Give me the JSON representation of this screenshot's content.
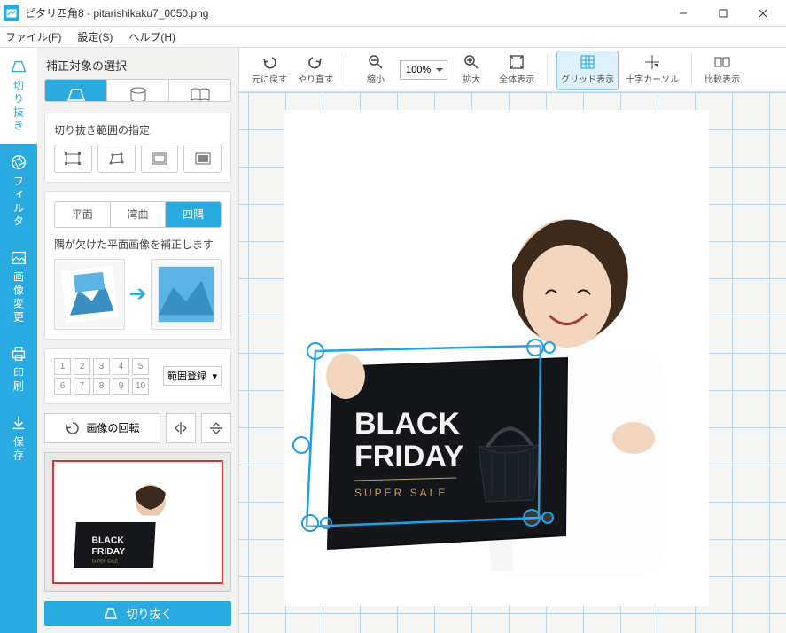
{
  "titlebar": {
    "title": "ピタリ四角8 - pitarishikaku7_0050.png"
  },
  "menu": {
    "file": "ファイル(F)",
    "settings": "設定(S)",
    "help": "ヘルプ(H)"
  },
  "vtabs": {
    "crop": "切り抜き",
    "filter": "フィルタ",
    "image": "画像変更",
    "print": "印刷",
    "save": "保存"
  },
  "panel": {
    "title": "補正対象の選択",
    "crop_range_title": "切り抜き範囲の指定",
    "plane_tabs": {
      "flat": "平面",
      "curve": "湾曲",
      "corner": "四隅"
    },
    "hint": "隅が欠けた平面画像を補正します",
    "range_register": "範囲登録",
    "numbers": [
      "1",
      "2",
      "3",
      "4",
      "5",
      "6",
      "7",
      "8",
      "9",
      "10"
    ],
    "rotate": "画像の回転",
    "crop_exec": "切り抜く"
  },
  "toolbar": {
    "undo": "元に戻す",
    "redo": "やり直す",
    "zoom_out": "縮小",
    "zoom_val": "100%",
    "zoom_in": "拡大",
    "fit": "全体表示",
    "grid": "グリッド表示",
    "cross": "十字カーソル",
    "compare": "比較表示"
  },
  "image_content": {
    "line1": "BLACK",
    "line2": "FRIDAY",
    "line3": "SUPER SALE"
  },
  "colors": {
    "accent": "#29abe2"
  }
}
